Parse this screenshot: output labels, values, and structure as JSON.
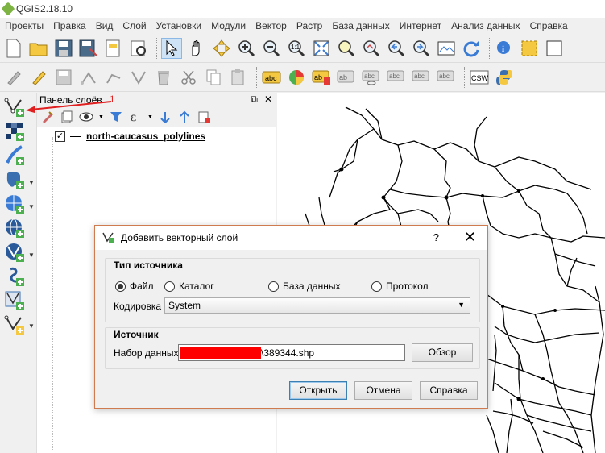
{
  "app": {
    "title": "QGIS2.18.10"
  },
  "menu": [
    "Проекты",
    "Правка",
    "Вид",
    "Слой",
    "Установки",
    "Модули",
    "Вектор",
    "Растр",
    "База данных",
    "Интернет",
    "Анализ данных",
    "Справка"
  ],
  "icons": {
    "toolbar1": [
      "new-project-icon",
      "open-project-icon",
      "save-project-icon",
      "save-as-icon",
      "new-print-composer-icon",
      "composer-manager-icon",
      "select-pan-icon",
      "pan-hand-icon",
      "pan-to-selection-icon",
      "zoom-in-icon",
      "zoom-out-icon",
      "zoom-native-icon",
      "zoom-full-icon",
      "zoom-to-selection-icon",
      "zoom-to-layer-icon",
      "zoom-last-icon",
      "zoom-next-icon",
      "new-map-view-icon",
      "refresh-icon",
      "identify-icon",
      "select-features-icon",
      "deselect-icon"
    ],
    "toolbar2": [
      "current-edits-icon",
      "toggle-editing-icon",
      "save-edits-icon",
      "add-feature-icon",
      "move-feature-icon",
      "node-tool-icon",
      "delete-selected-icon",
      "cut-features-icon",
      "copy-features-icon",
      "paste-features-icon",
      "label-toolbar-icon",
      "diagram-icon",
      "layer-labeling-icon",
      "pin-labels-icon",
      "show-hide-labels-icon",
      "move-label-icon",
      "rotate-label-icon",
      "change-label-icon",
      "csw-icon",
      "python-console-icon"
    ],
    "leftbar": [
      "add-vector-layer-icon",
      "add-raster-layer-icon",
      "add-delimited-text-icon",
      "add-postgis-icon",
      "add-spatialite-icon",
      "add-wms-icon",
      "add-wfs-icon",
      "add-wcs-icon",
      "add-virtual-layer-icon",
      "new-shapefile-icon"
    ]
  },
  "toolbar2": {
    "csw_label": "CSW"
  },
  "layers_panel": {
    "title": "Панель слоёв",
    "layers": [
      {
        "name": "north-caucasus_polylines",
        "checked": true
      }
    ]
  },
  "annotation": {
    "number": "1",
    "color": "#e02020"
  },
  "dialog": {
    "title": "Добавить векторный слой",
    "help": "?",
    "close": "✕",
    "source_type": {
      "title": "Тип источника",
      "options": [
        "Файл",
        "Каталог",
        "База данных",
        "Протокол"
      ],
      "selected": "Файл",
      "encoding_label": "Кодировка",
      "encoding_value": "System"
    },
    "source": {
      "title": "Источник",
      "dataset_label": "Набор данных",
      "dataset_value": "\\389344.shp",
      "browse_label": "Обзор"
    },
    "buttons": {
      "open": "Открыть",
      "cancel": "Отмена",
      "help": "Справка"
    }
  },
  "colors": {
    "accent_border": "#d07a50",
    "redaction": "#ff0000",
    "qgis_green": "#7cb342"
  }
}
